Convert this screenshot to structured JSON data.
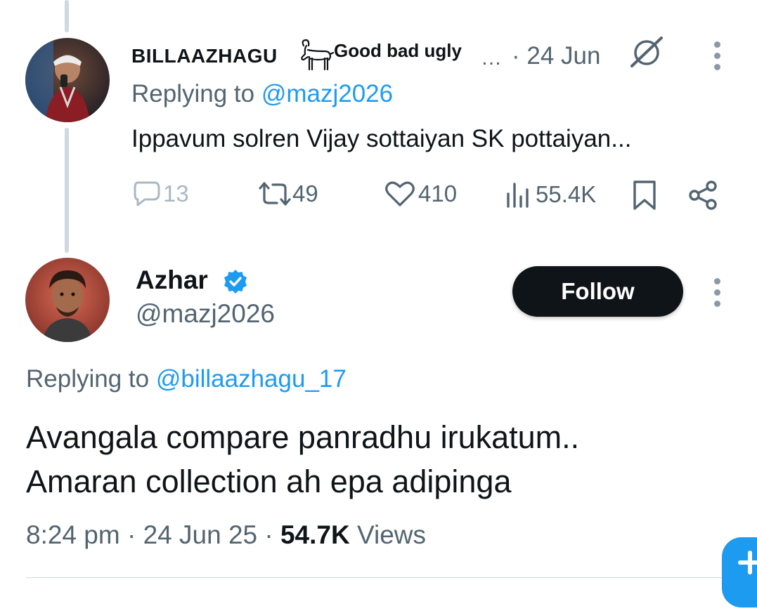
{
  "reply_tweet": {
    "display_name": "BILLAAZHAGU",
    "name_suffix": "Good bad ugly",
    "ellipsis": "…",
    "date": "· 24 Jun",
    "replying_prefix": "Replying to ",
    "replying_handle": "@mazj2026",
    "text": "Ippavum solren Vijay sottaiyan SK pottaiyan...",
    "stats": {
      "replies": "13",
      "reposts": "49",
      "likes": "410",
      "views": "55.4K"
    }
  },
  "main_tweet": {
    "display_name": "Azhar",
    "handle": "@mazj2026",
    "follow_label": "Follow",
    "replying_prefix": "Replying to ",
    "replying_handle": "@billaazhagu_17",
    "text_line1": "Avangala compare panradhu irukatum..",
    "text_line2": "Amaran collection ah epa adipinga",
    "time": "8:24 pm · 24 Jun 25 · ",
    "views_count": "54.7K",
    "views_label": " Views"
  },
  "colors": {
    "accent": "#1d9bf0",
    "text_primary": "#0f1419",
    "text_secondary": "#536471",
    "follow_bg": "#0f1419",
    "thread_line": "#cfd9de"
  },
  "icons": {
    "goat": "goat-emoji-icon",
    "grok": "grok-slash-icon",
    "more": "more-vertical-icon",
    "reply": "speech-bubble-icon",
    "repost": "repost-arrows-icon",
    "like": "heart-icon",
    "views": "bar-chart-icon",
    "bookmark": "bookmark-icon",
    "share": "share-icon",
    "verified": "verified-badge-icon"
  }
}
